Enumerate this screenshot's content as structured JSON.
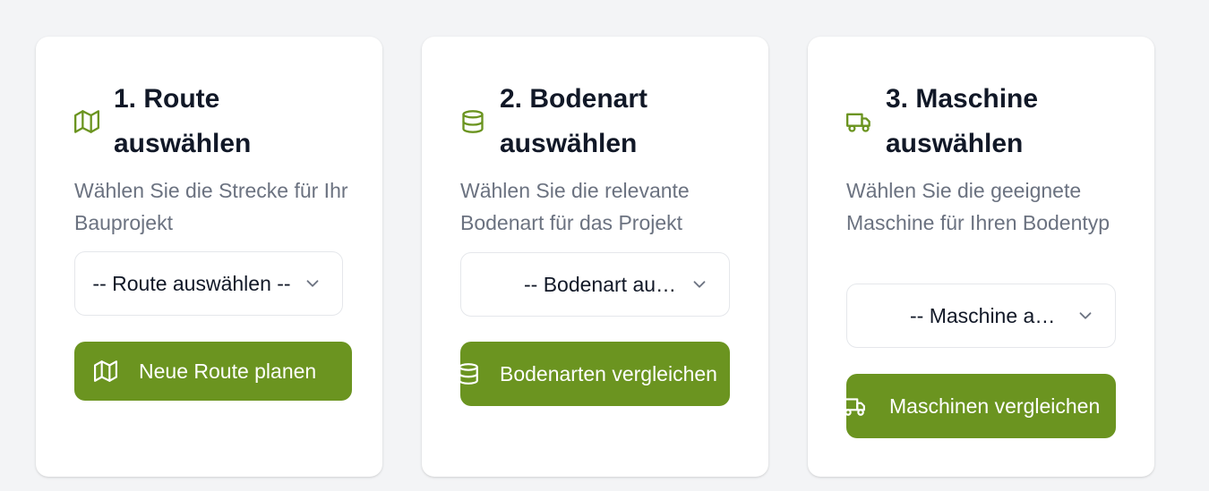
{
  "cards": [
    {
      "title": "1. Route auswählen",
      "description": "Wählen Sie die Strecke für Ihr Bauprojekt",
      "select_value": "-- Route auswählen --",
      "button_label": "Neue Route planen",
      "icon": "map-icon"
    },
    {
      "title": "2. Bodenart auswählen",
      "description": "Wählen Sie die relevante Bodenart für das Projekt",
      "select_value": "-- Bodenart auswählen --",
      "button_label": "Bodenarten vergleichen",
      "icon": "database-icon"
    },
    {
      "title": "3. Maschine auswählen",
      "description": "Wählen Sie die geeignete Maschine für Ihren Bodentyp",
      "select_value": "-- Maschine auswählen --",
      "button_label": "Maschinen vergleichen",
      "icon": "truck-icon"
    }
  ],
  "colors": {
    "accent": "#6b9420",
    "page_background": "#f3f4f6",
    "title_text": "#111827",
    "muted_text": "#6b7280"
  }
}
